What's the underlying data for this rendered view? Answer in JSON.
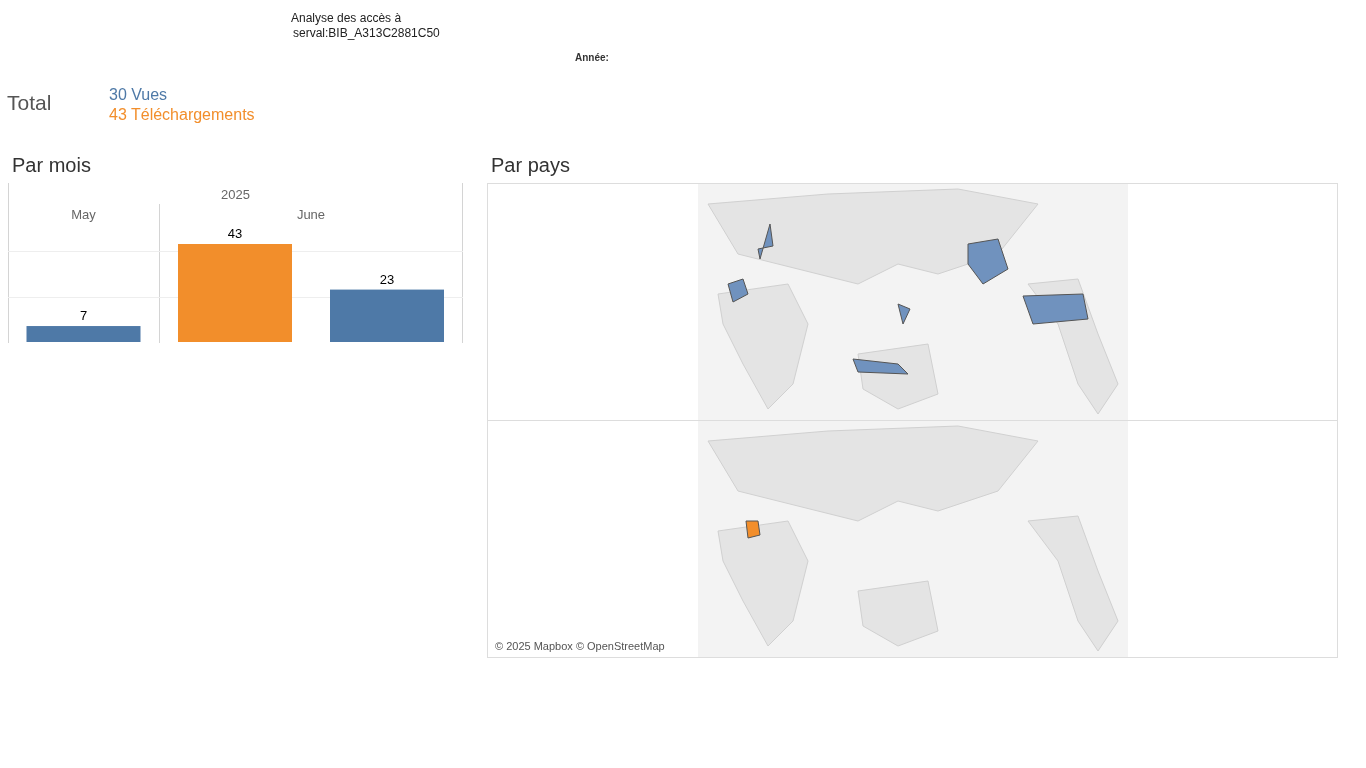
{
  "header": {
    "title": "Analyse des accès à",
    "subtitle": "serval:BIB_A313C2881C50",
    "year_filter_label": "Année:"
  },
  "totals": {
    "label": "Total",
    "items": [
      {
        "text": "30 Vues",
        "color": "#4e79a7"
      },
      {
        "text": "43 Téléchargements",
        "color": "#f28e2b"
      }
    ]
  },
  "by_month": {
    "title": "Par mois",
    "year": "2025",
    "chart_data": {
      "type": "bar",
      "categories": [
        "May",
        "June"
      ],
      "series": [
        {
          "color": "#f28e2b",
          "values": [
            null,
            43
          ]
        },
        {
          "color": "#4e79a7",
          "values": [
            7,
            23
          ]
        }
      ],
      "data_labels": true
    }
  },
  "by_country": {
    "title": "Par pays",
    "maps": [
      {
        "color": "#7092be"
      },
      {
        "color": "#f28e2b"
      }
    ],
    "attribution": "© 2025 Mapbox © OpenStreetMap"
  }
}
